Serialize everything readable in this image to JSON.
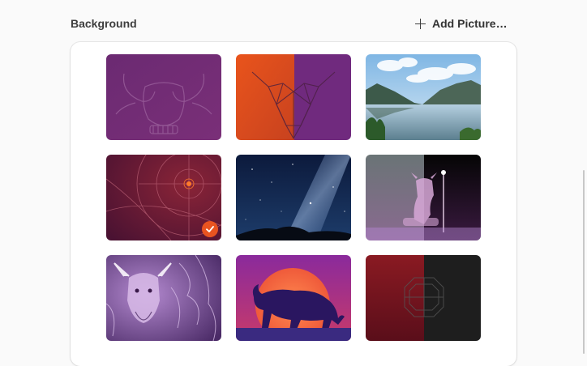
{
  "section": {
    "title": "Background",
    "add_button_label": "Add Picture…"
  },
  "wallpapers": [
    {
      "name": "purple-bull-outline",
      "selected": false
    },
    {
      "name": "orange-purple-geometric-bull",
      "selected": false
    },
    {
      "name": "mountain-lake",
      "selected": false
    },
    {
      "name": "radar-circles",
      "selected": true
    },
    {
      "name": "milky-way-night",
      "selected": false
    },
    {
      "name": "horned-warrior-split",
      "selected": false
    },
    {
      "name": "purple-bull-creature",
      "selected": false
    },
    {
      "name": "bull-sunset",
      "selected": false
    },
    {
      "name": "dark-red-split-emblem",
      "selected": false
    }
  ],
  "colors": {
    "accent": "#e95420"
  },
  "icons": {
    "add": "plus-icon",
    "selected": "checkmark-icon"
  }
}
